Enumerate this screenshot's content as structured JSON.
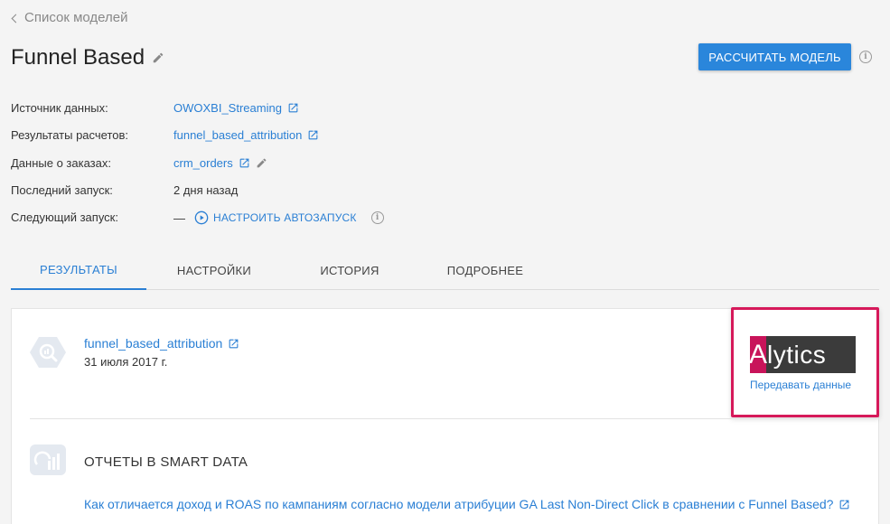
{
  "nav": {
    "back_label": "Список моделей"
  },
  "header": {
    "title": "Funnel Based",
    "calc_button": "РАССЧИТАТЬ МОДЕЛЬ"
  },
  "details": {
    "source_label": "Источник данных:",
    "source_value": "OWOXBI_Streaming",
    "results_label": "Результаты расчетов:",
    "results_value": "funnel_based_attribution",
    "orders_label": "Данные о заказах:",
    "orders_value": "crm_orders",
    "last_run_label": "Последний запуск:",
    "last_run_value": "2 дня назад",
    "next_run_label": "Следующий запуск:",
    "next_run_value": "—",
    "autorun_action": "НАСТРОИТЬ АВТОЗАПУСК"
  },
  "tabs": [
    "РЕЗУЛЬТАТЫ",
    "НАСТРОЙКИ",
    "ИСТОРИЯ",
    "ПОДРОБНЕЕ"
  ],
  "result": {
    "table_name": "funnel_based_attribution",
    "date": "31 июля 2017 г."
  },
  "integration": {
    "logo_first": "A",
    "logo_rest": "lytics",
    "action": "Передавать данные"
  },
  "smart_data": {
    "title": "ОТЧЕТЫ В SMART DATA",
    "question": "Как отличается доход и ROAS по кампаниям согласно модели атрибуции GA Last Non-Direct Click в сравнении с Funnel Based?"
  },
  "colors": {
    "accent": "#2a86db",
    "highlight": "#d6195a",
    "alytics_brand": "#c8145a"
  }
}
